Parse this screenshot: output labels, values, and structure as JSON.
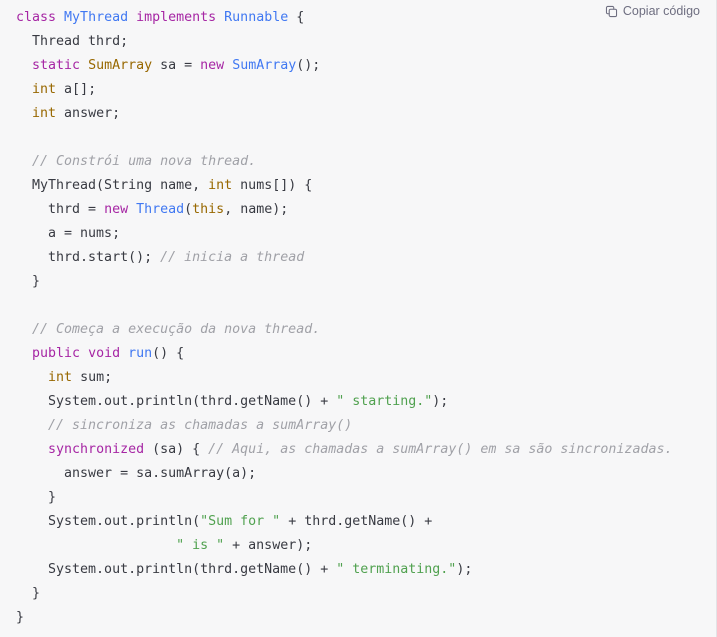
{
  "copy_button": {
    "label": "Copiar código",
    "icon": "copy-icon"
  },
  "colors": {
    "background": "#f7f7f8",
    "plain": "#383a42",
    "keyword": "#a626a4",
    "type": "#4078f2",
    "builtin": "#986801",
    "string": "#50a14f",
    "comment": "#a0a1a7",
    "border": "#e3e3e6"
  },
  "code": {
    "language": "java",
    "lines": [
      {
        "tokens": [
          {
            "t": "class ",
            "c": "keyword"
          },
          {
            "t": "MyThread ",
            "c": "type"
          },
          {
            "t": "implements ",
            "c": "keyword"
          },
          {
            "t": "Runnable ",
            "c": "type"
          },
          {
            "t": "{",
            "c": "plain"
          }
        ]
      },
      {
        "tokens": [
          {
            "t": "  Thread thrd;",
            "c": "plain"
          }
        ]
      },
      {
        "tokens": [
          {
            "t": "  ",
            "c": "plain"
          },
          {
            "t": "static ",
            "c": "keyword"
          },
          {
            "t": "SumArray",
            "c": "builtin"
          },
          {
            "t": " sa = ",
            "c": "plain"
          },
          {
            "t": "new ",
            "c": "keyword"
          },
          {
            "t": "SumArray",
            "c": "type"
          },
          {
            "t": "();",
            "c": "plain"
          }
        ]
      },
      {
        "tokens": [
          {
            "t": "  ",
            "c": "plain"
          },
          {
            "t": "int",
            "c": "builtin"
          },
          {
            "t": " a[];",
            "c": "plain"
          }
        ]
      },
      {
        "tokens": [
          {
            "t": "  ",
            "c": "plain"
          },
          {
            "t": "int",
            "c": "builtin"
          },
          {
            "t": " answer;",
            "c": "plain"
          }
        ]
      },
      {
        "tokens": []
      },
      {
        "tokens": [
          {
            "t": "  // Constrói uma nova thread.",
            "c": "comment"
          }
        ]
      },
      {
        "tokens": [
          {
            "t": "  MyThread(String name, ",
            "c": "plain"
          },
          {
            "t": "int",
            "c": "builtin"
          },
          {
            "t": " nums[]) {",
            "c": "plain"
          }
        ]
      },
      {
        "tokens": [
          {
            "t": "    thrd = ",
            "c": "plain"
          },
          {
            "t": "new ",
            "c": "keyword"
          },
          {
            "t": "Thread",
            "c": "type"
          },
          {
            "t": "(",
            "c": "plain"
          },
          {
            "t": "this",
            "c": "builtin"
          },
          {
            "t": ", name);",
            "c": "plain"
          }
        ]
      },
      {
        "tokens": [
          {
            "t": "    a = nums;",
            "c": "plain"
          }
        ]
      },
      {
        "tokens": [
          {
            "t": "    thrd.start(); ",
            "c": "plain"
          },
          {
            "t": "// inicia a thread",
            "c": "comment"
          }
        ]
      },
      {
        "tokens": [
          {
            "t": "  }",
            "c": "plain"
          }
        ]
      },
      {
        "tokens": []
      },
      {
        "tokens": [
          {
            "t": "  // Começa a execução da nova thread.",
            "c": "comment"
          }
        ]
      },
      {
        "tokens": [
          {
            "t": "  ",
            "c": "plain"
          },
          {
            "t": "public ",
            "c": "keyword"
          },
          {
            "t": "void ",
            "c": "keyword"
          },
          {
            "t": "run",
            "c": "function"
          },
          {
            "t": "() {",
            "c": "plain"
          }
        ]
      },
      {
        "tokens": [
          {
            "t": "    ",
            "c": "plain"
          },
          {
            "t": "int",
            "c": "builtin"
          },
          {
            "t": " sum;",
            "c": "plain"
          }
        ]
      },
      {
        "tokens": [
          {
            "t": "    System.out.println(thrd.getName() + ",
            "c": "plain"
          },
          {
            "t": "\" starting.\"",
            "c": "string"
          },
          {
            "t": ");",
            "c": "plain"
          }
        ]
      },
      {
        "tokens": [
          {
            "t": "    // sincroniza as chamadas a sumArray()",
            "c": "comment"
          }
        ]
      },
      {
        "tokens": [
          {
            "t": "    ",
            "c": "plain"
          },
          {
            "t": "synchronized ",
            "c": "keyword"
          },
          {
            "t": "(sa) { ",
            "c": "plain"
          },
          {
            "t": "// Aqui, as chamadas a sumArray() em sa são sincronizadas.",
            "c": "comment"
          }
        ]
      },
      {
        "tokens": [
          {
            "t": "      answer = sa.sumArray(a);",
            "c": "plain"
          }
        ]
      },
      {
        "tokens": [
          {
            "t": "    }",
            "c": "plain"
          }
        ]
      },
      {
        "tokens": [
          {
            "t": "    System.out.println(",
            "c": "plain"
          },
          {
            "t": "\"Sum for \"",
            "c": "string"
          },
          {
            "t": " + thrd.getName() +",
            "c": "plain"
          }
        ]
      },
      {
        "tokens": [
          {
            "t": "                    ",
            "c": "plain"
          },
          {
            "t": "\" is \"",
            "c": "string"
          },
          {
            "t": " + answer);",
            "c": "plain"
          }
        ]
      },
      {
        "tokens": [
          {
            "t": "    System.out.println(thrd.getName() + ",
            "c": "plain"
          },
          {
            "t": "\" terminating.\"",
            "c": "string"
          },
          {
            "t": ");",
            "c": "plain"
          }
        ]
      },
      {
        "tokens": [
          {
            "t": "  }",
            "c": "plain"
          }
        ]
      },
      {
        "tokens": [
          {
            "t": "}",
            "c": "plain"
          }
        ]
      }
    ]
  }
}
